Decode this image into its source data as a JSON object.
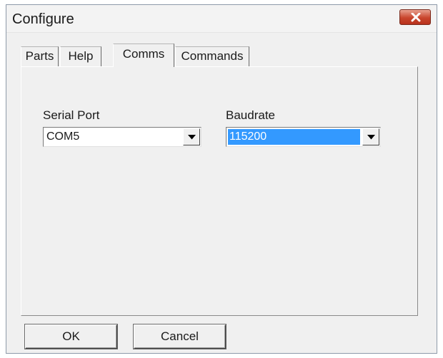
{
  "window": {
    "title": "Configure",
    "close_icon": "close-icon"
  },
  "tabs": [
    {
      "label": "Parts",
      "active": false
    },
    {
      "label": "Help",
      "active": false
    },
    {
      "label": "Comms",
      "active": true
    },
    {
      "label": "Commands",
      "active": false
    }
  ],
  "comms": {
    "serial_port": {
      "label": "Serial Port",
      "value": "COM5"
    },
    "baudrate": {
      "label": "Baudrate",
      "value": "115200"
    }
  },
  "buttons": {
    "ok_label": "OK",
    "cancel_label": "Cancel"
  },
  "colors": {
    "selection": "#3399ff",
    "close_button": "#c9452d"
  }
}
